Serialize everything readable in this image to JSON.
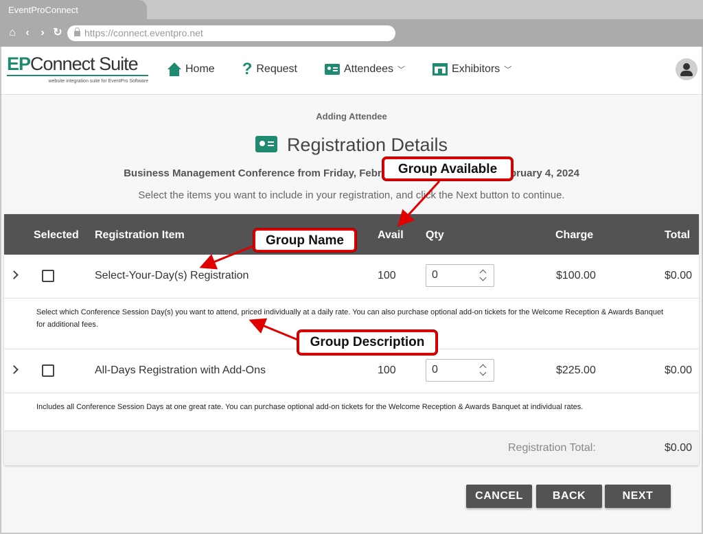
{
  "browser": {
    "tab_title": "EventProConnect",
    "url": "https://connect.eventpro.net"
  },
  "logo": {
    "ep": "EP",
    "connect_suite": "Connect Suite",
    "tagline": "website integration suite for EventPro Software"
  },
  "nav": {
    "home": "Home",
    "request": "Request",
    "attendees": "Attendees",
    "exhibitors": "Exhibitors"
  },
  "page": {
    "subtitle": "Adding Attendee",
    "title": "Registration Details",
    "event_line": "Business Management Conference from Friday, February 2, 2024 to Sunday, February 4, 2024",
    "instructions": "Select the items you want to include in your registration, and click the Next button to continue."
  },
  "table": {
    "headers": {
      "selected": "Selected",
      "item": "Registration Item",
      "avail": "Avail",
      "qty": "Qty",
      "charge": "Charge",
      "total": "Total"
    },
    "rows": [
      {
        "name": "Select-Your-Day(s) Registration",
        "avail": "100",
        "qty": "0",
        "charge": "$100.00",
        "total": "$0.00",
        "description": "Select which Conference Session Day(s) you want to attend, priced individually at a daily rate. You can also purchase optional add-on tickets for the Welcome Reception & Awards Banquet for additional fees."
      },
      {
        "name": "All-Days Registration with Add-Ons",
        "avail": "100",
        "qty": "0",
        "charge": "$225.00",
        "total": "$0.00",
        "description": "Includes all Conference Session Days at one great rate. You can purchase optional add-on tickets for the Welcome Reception & Awards Banquet at individual rates."
      }
    ],
    "registration_total_label": "Registration Total:",
    "registration_total_value": "$0.00"
  },
  "buttons": {
    "cancel": "CANCEL",
    "back": "BACK",
    "next": "NEXT"
  },
  "callouts": {
    "group_available": "Group Available",
    "group_name": "Group Name",
    "group_description": "Group Description"
  },
  "colors": {
    "accent": "#1f8a70",
    "header_bg": "#535353",
    "callout_border": "#e00000"
  }
}
